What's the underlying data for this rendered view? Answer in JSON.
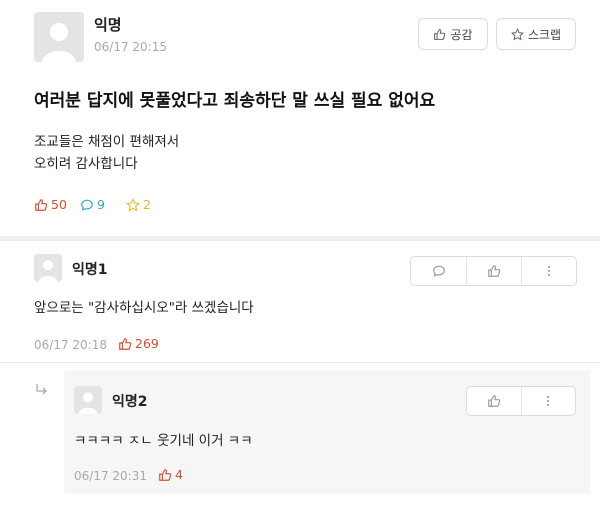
{
  "post": {
    "nickname": "익명",
    "time": "06/17 20:15",
    "like_button_label": "공감",
    "scrap_button_label": "스크랩",
    "title": "여러분 답지에 못풀었다고 죄송하단 말 쓰실 필요 없어요",
    "body_lines": [
      "조교들은 채점이 편해져서",
      "오히려 감사합니다"
    ],
    "stats": {
      "likes": "50",
      "comments": "9",
      "scraps": "2"
    }
  },
  "comments": [
    {
      "nickname": "익명1",
      "text": "앞으로는 \"감사하십시오\"라 쓰겠습니다",
      "time": "06/17 20:18",
      "likes": "269"
    }
  ],
  "reply": {
    "nickname": "익명2",
    "text": "ㅋㅋㅋㅋ ㅈㄴ 웃기네 이거 ㅋㅋ",
    "time": "06/17 20:31",
    "likes": "4"
  },
  "colors": {
    "like_red": "#d94b2b",
    "comment_teal": "#2fa8c2",
    "scrap_yellow": "#e8b923",
    "muted": "#a9a9a9"
  },
  "icons": {
    "avatar": "person-silhouette-icon",
    "like": "thumbs-up-icon",
    "scrap": "star-icon",
    "comment": "speech-bubble-icon",
    "more": "vertical-dots-icon",
    "reply": "reply-arrow-icon"
  }
}
